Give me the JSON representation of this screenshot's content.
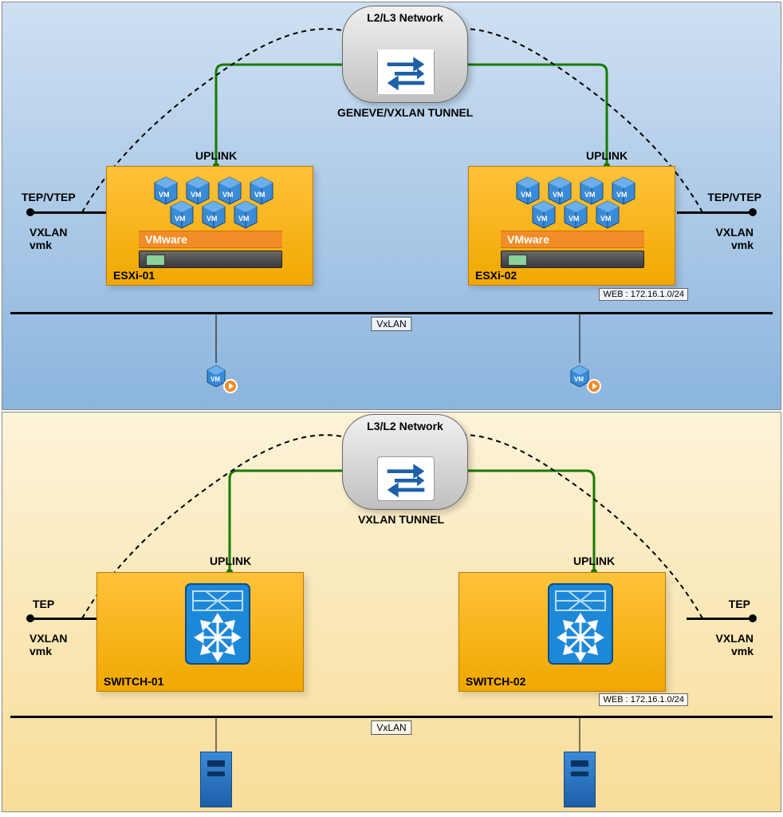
{
  "top": {
    "cloud_title": "L2/L3 Network",
    "tunnel_label": "GENEVE/VXLAN TUNNEL",
    "uplink_left": "UPLINK",
    "uplink_right": "UPLINK",
    "tep_left": "TEP/VTEP",
    "tep_right": "TEP/VTEP",
    "vxlan_vmk_left": "VXLAN\nvmk",
    "vxlan_vmk_right": "VXLAN\nvmk",
    "host_left": "ESXi-01",
    "host_right": "ESXi-02",
    "vmware_label": "VMware",
    "web_label": "WEB : 172.16.1.0/24",
    "vxlan_line_label": "VxLAN",
    "vm_cube_text": "VM"
  },
  "bottom": {
    "cloud_title": "L3/L2 Network",
    "tunnel_label": "VXLAN TUNNEL",
    "uplink_left": "UPLINK",
    "uplink_right": "UPLINK",
    "tep_left": "TEP",
    "tep_right": "TEP",
    "vxlan_vmk_left": "VXLAN\nvmk",
    "vxlan_vmk_right": "VXLAN\nvmk",
    "host_left": "SWITCH-01",
    "host_right": "SWITCH-02",
    "web_label": "WEB : 172.16.1.0/24",
    "vxlan_line_label": "VxLAN"
  }
}
